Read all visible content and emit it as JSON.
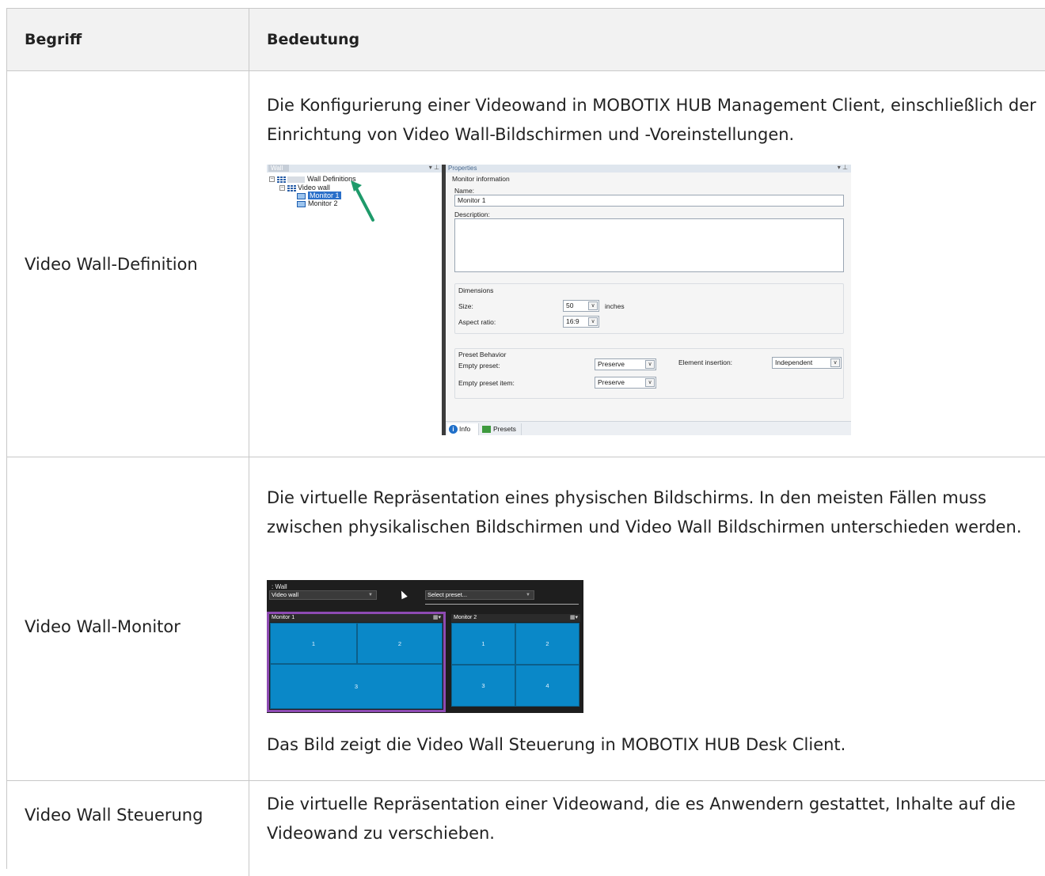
{
  "table": {
    "headers": [
      "Begriff",
      "Bedeutung"
    ],
    "rows": [
      {
        "term": "Video Wall-Definition",
        "description": "Die Konfigurierung einer Videowand in MOBOTIX HUB Management Client, einschließlich der Einrichtung von Video Wall-Bildschirmen und -Voreinstellungen."
      },
      {
        "term": "Video Wall-Monitor",
        "description": "Die virtuelle Repräsentation eines physischen Bildschirms. In den meisten Fällen muss zwischen physikalischen Bildschirmen und Video Wall Bildschirmen unterschieden werden.",
        "caption": "Das Bild zeigt die Video Wall Steuerung in MOBOTIX HUB Desk Client."
      },
      {
        "term": "Video Wall Steuerung",
        "description": "Die virtuelle Repräsentation einer Videowand, die es Anwendern gestattet, Inhalte auf die Videowand zu verschieben."
      }
    ]
  },
  "screenshot_management": {
    "left_panel_title": "Wall",
    "tree": {
      "root": "Wall Definitions",
      "wall": "Video wall",
      "monitors": [
        "Monitor 1",
        "Monitor 2"
      ]
    },
    "right_panel_title": "Properties",
    "monitor_information": "Monitor information",
    "name_label": "Name:",
    "name_value": "Monitor 1",
    "description_label": "Description:",
    "dimensions_title": "Dimensions",
    "size_label": "Size:",
    "size_value": "50",
    "size_unit": "inches",
    "aspect_label": "Aspect ratio:",
    "aspect_value": "16:9",
    "preset_title": "Preset Behavior",
    "empty_preset_label": "Empty preset:",
    "empty_preset_value": "Preserve",
    "empty_preset_item_label": "Empty preset item:",
    "empty_preset_item_value": "Preserve",
    "element_insertion_label": "Element insertion:",
    "element_insertion_value": "Independent",
    "tabs": [
      "Info",
      "Presets"
    ],
    "accent_arrow_color": "#1e9a6a"
  },
  "screenshot_desk": {
    "title": ": Wall",
    "wall_select": "Video wall",
    "preset_select": "Select preset...",
    "monitor1": {
      "name": "Monitor 1",
      "tiles": [
        "1",
        "2",
        "3"
      ]
    },
    "monitor2": {
      "name": "Monitor 2",
      "tiles": [
        "1",
        "2",
        "3",
        "4"
      ]
    },
    "layout_icon": "grid-layout-icon",
    "selected_border_color": "#8e4bb3",
    "tile_color": "#0a88c8"
  }
}
